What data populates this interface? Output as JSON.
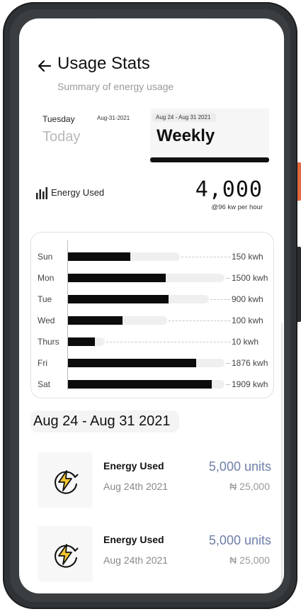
{
  "header": {
    "title": "Usage Stats",
    "subtitle": "Summary of energy usage"
  },
  "tabs": {
    "today": {
      "day": "Tuesday",
      "date": "Aug-31-2021",
      "label": "Today"
    },
    "weekly": {
      "range": "Aug 24 - Aug 31  2021",
      "label": "Weekly"
    }
  },
  "energy": {
    "label": "Energy Used",
    "value": "4,000",
    "rate": "@96 kw per hour"
  },
  "chart_data": {
    "type": "bar",
    "orientation": "horizontal",
    "categories": [
      "Sun",
      "Mon",
      "Tue",
      "Wed",
      "Thurs",
      "Fri",
      "Sat"
    ],
    "value_labels": [
      "150 kwh",
      "1500 kwh",
      "900 kwh",
      "100 kwh",
      "10 kwh",
      "1876 kwh",
      "1909 kwh"
    ],
    "values": [
      150,
      1500,
      900,
      100,
      10,
      1876,
      1909
    ],
    "bar_fill": [
      0.39,
      0.61,
      0.63,
      0.34,
      0.17,
      0.8,
      0.9
    ],
    "track_fill": [
      0.7,
      0.98,
      0.88,
      0.62,
      0.23,
      0.98,
      0.98
    ]
  },
  "period": {
    "label": "Aug 24 - Aug 31  2021"
  },
  "records": [
    {
      "name": "Energy Used",
      "date": "Aug 24th 2021",
      "units": "5,000 units",
      "amount": "₦ 25,000"
    },
    {
      "name": "Energy Used",
      "date": "Aug 24th 2021",
      "units": "5,000 units",
      "amount": "₦ 25,000"
    }
  ],
  "colors": {
    "bar": "#0c0c0c",
    "track": "#efefef",
    "units": "#6f7fa8",
    "bolt": "#f4c430",
    "accent_button": "#e2683f"
  },
  "icons": {
    "back": "arrow-left-icon",
    "energy": "bar-chart-icon",
    "record": "lightning-bolt-icon"
  }
}
